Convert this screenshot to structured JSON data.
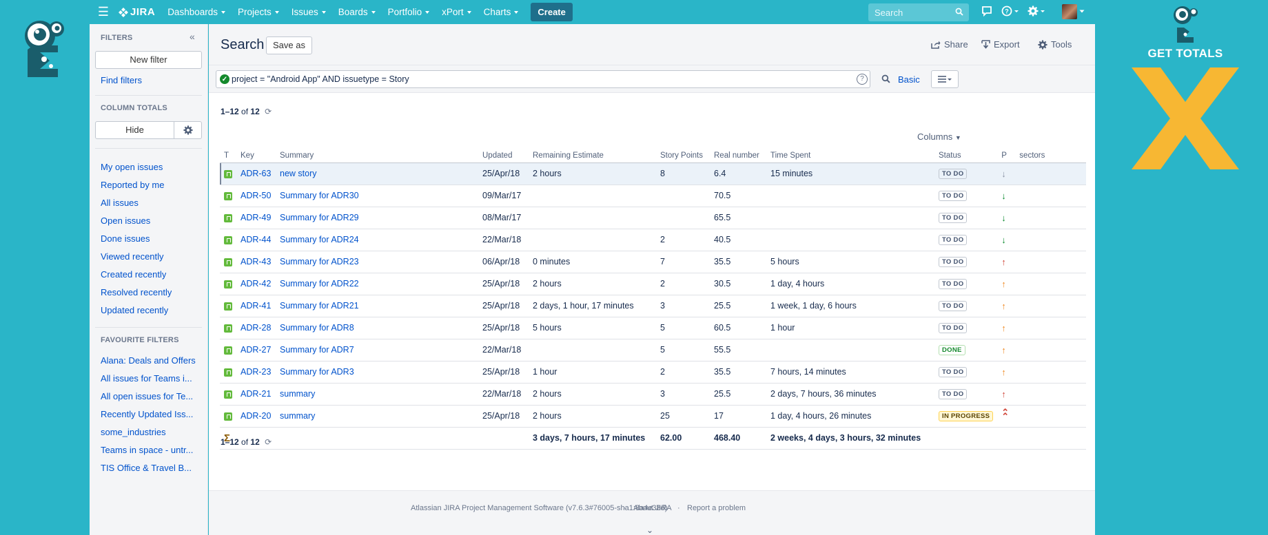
{
  "promo": {
    "title": "GET TOTALS"
  },
  "topnav": {
    "logo": "JIRA",
    "menus": [
      {
        "label": "Dashboards"
      },
      {
        "label": "Projects"
      },
      {
        "label": "Issues"
      },
      {
        "label": "Boards"
      },
      {
        "label": "Portfolio"
      },
      {
        "label": "xPort"
      },
      {
        "label": "Charts"
      }
    ],
    "create_label": "Create",
    "search_placeholder": "Search"
  },
  "sidebar": {
    "filters_header": "FILTERS",
    "new_filter": "New filter",
    "find_filters": "Find filters",
    "column_totals_header": "COLUMN TOTALS",
    "hide_label": "Hide",
    "system_filters": [
      "My open issues",
      "Reported by me",
      "All issues",
      "Open issues",
      "Done issues",
      "Viewed recently",
      "Created recently",
      "Resolved recently",
      "Updated recently"
    ],
    "favourite_header": "FAVOURITE FILTERS",
    "favourites": [
      "Alana: Deals and Offers",
      "All issues for Teams i...",
      "All open issues for Te...",
      "Recently Updated Iss...",
      "some_industries",
      "Teams in space - untr...",
      "TIS Office & Travel B..."
    ]
  },
  "header": {
    "title": "Search",
    "save_as": "Save as",
    "share": "Share",
    "export": "Export",
    "tools": "Tools"
  },
  "search": {
    "jql": "project = \"Android App\" AND issuetype = Story",
    "basic": "Basic"
  },
  "results": {
    "range": "1–12",
    "of": "of",
    "total": "12",
    "columns_label": "Columns"
  },
  "table": {
    "headers": {
      "type": "T",
      "key": "Key",
      "summary": "Summary",
      "updated": "Updated",
      "remaining": "Remaining Estimate",
      "points": "Story Points",
      "real": "Real number",
      "spent": "Time Spent",
      "status": "Status",
      "priority": "P",
      "sectors": "sectors"
    },
    "rows": [
      {
        "key": "ADR-63",
        "summary": "new story",
        "updated": "25/Apr/18",
        "remaining": "2 hours",
        "points": "8",
        "real": "6.4",
        "spent": "15 minutes",
        "status": "TO DO",
        "priority": "low",
        "priority_color": "#8993a4"
      },
      {
        "key": "ADR-50",
        "summary": "Summary for ADR30",
        "updated": "09/Mar/17",
        "remaining": "",
        "points": "",
        "real": "70.5",
        "spent": "",
        "status": "TO DO",
        "priority": "low",
        "priority_color": "#0a8a2e"
      },
      {
        "key": "ADR-49",
        "summary": "Summary for ADR29",
        "updated": "08/Mar/17",
        "remaining": "",
        "points": "",
        "real": "65.5",
        "spent": "",
        "status": "TO DO",
        "priority": "low",
        "priority_color": "#0a8a2e"
      },
      {
        "key": "ADR-44",
        "summary": "Summary for ADR24",
        "updated": "22/Mar/18",
        "remaining": "",
        "points": "2",
        "real": "40.5",
        "spent": "",
        "status": "TO DO",
        "priority": "low",
        "priority_color": "#0a8a2e"
      },
      {
        "key": "ADR-43",
        "summary": "Summary for ADR23",
        "updated": "06/Apr/18",
        "remaining": "0 minutes",
        "points": "7",
        "real": "35.5",
        "spent": "5 hours",
        "status": "TO DO",
        "priority": "high",
        "priority_color": "#d04437"
      },
      {
        "key": "ADR-42",
        "summary": "Summary for ADR22",
        "updated": "25/Apr/18",
        "remaining": "2 hours",
        "points": "2",
        "real": "30.5",
        "spent": "1 day, 4 hours",
        "status": "TO DO",
        "priority": "medium",
        "priority_color": "#f08a24"
      },
      {
        "key": "ADR-41",
        "summary": "Summary for ADR21",
        "updated": "25/Apr/18",
        "remaining": "2 days, 1 hour, 17 minutes",
        "points": "3",
        "real": "25.5",
        "spent": "1 week, 1 day, 6 hours",
        "status": "TO DO",
        "priority": "medium",
        "priority_color": "#f08a24"
      },
      {
        "key": "ADR-28",
        "summary": "Summary for ADR8",
        "updated": "25/Apr/18",
        "remaining": "5 hours",
        "points": "5",
        "real": "60.5",
        "spent": "1 hour",
        "status": "TO DO",
        "priority": "medium",
        "priority_color": "#f08a24"
      },
      {
        "key": "ADR-27",
        "summary": "Summary for ADR7",
        "updated": "22/Mar/18",
        "remaining": "",
        "points": "5",
        "real": "55.5",
        "spent": "",
        "status": "DONE",
        "priority": "medium",
        "priority_color": "#f08a24"
      },
      {
        "key": "ADR-23",
        "summary": "Summary for ADR3",
        "updated": "25/Apr/18",
        "remaining": "1 hour",
        "points": "2",
        "real": "35.5",
        "spent": "7 hours, 14 minutes",
        "status": "TO DO",
        "priority": "medium",
        "priority_color": "#f08a24"
      },
      {
        "key": "ADR-21",
        "summary": "summary",
        "updated": "22/Mar/18",
        "remaining": "2 hours",
        "points": "3",
        "real": "25.5",
        "spent": "2 days, 7 hours, 36 minutes",
        "status": "TO DO",
        "priority": "high",
        "priority_color": "#d04437"
      },
      {
        "key": "ADR-20",
        "summary": "summary",
        "updated": "25/Apr/18",
        "remaining": "2 hours",
        "points": "25",
        "real": "17",
        "spent": "1 day, 4 hours, 26 minutes",
        "status": "IN PROGRESS",
        "priority": "highest",
        "priority_color": "#d04437"
      }
    ],
    "totals": {
      "remaining": "3 days, 7 hours, 17 minutes",
      "points": "62.00",
      "real": "468.40",
      "spent": "2 weeks, 4 days, 3 hours, 32 minutes"
    }
  },
  "footer": {
    "version": "Atlassian JIRA Project Management Software (v7.6.3#76005-sha1:8a4e38d)",
    "about": "About JIRA",
    "report": "Report a problem"
  }
}
